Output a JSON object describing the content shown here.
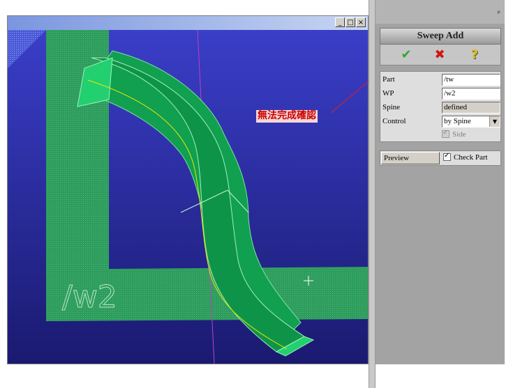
{
  "window": {
    "minimize_glyph": "_",
    "restore_glyph": "□",
    "close_glyph": "×"
  },
  "viewport": {
    "wp_label": "/w2",
    "colors": {
      "background": "#3232b0",
      "plane": "#2c9a5a",
      "surface": "#10a050",
      "surface_light": "#22d070",
      "spine": "#e8e800",
      "axis": "#c040c0"
    }
  },
  "annotation": {
    "text": "無法完成確認",
    "color": "#cc0000"
  },
  "panel": {
    "pin_glyph": "ᵖ",
    "title": "Sweep Add",
    "actions": {
      "ok_glyph": "✔",
      "cancel_glyph": "✖",
      "help_glyph": "?"
    },
    "fields": {
      "part_label": "Part",
      "part_value": "/tw",
      "wp_label": "WP",
      "wp_value": "/w2",
      "spine_label": "Spine",
      "spine_value": "defined",
      "control_label": "Control",
      "control_value": "by Spine",
      "side_label": "Side"
    },
    "preview_label": "Preview",
    "check_part_label": "Check Part"
  }
}
